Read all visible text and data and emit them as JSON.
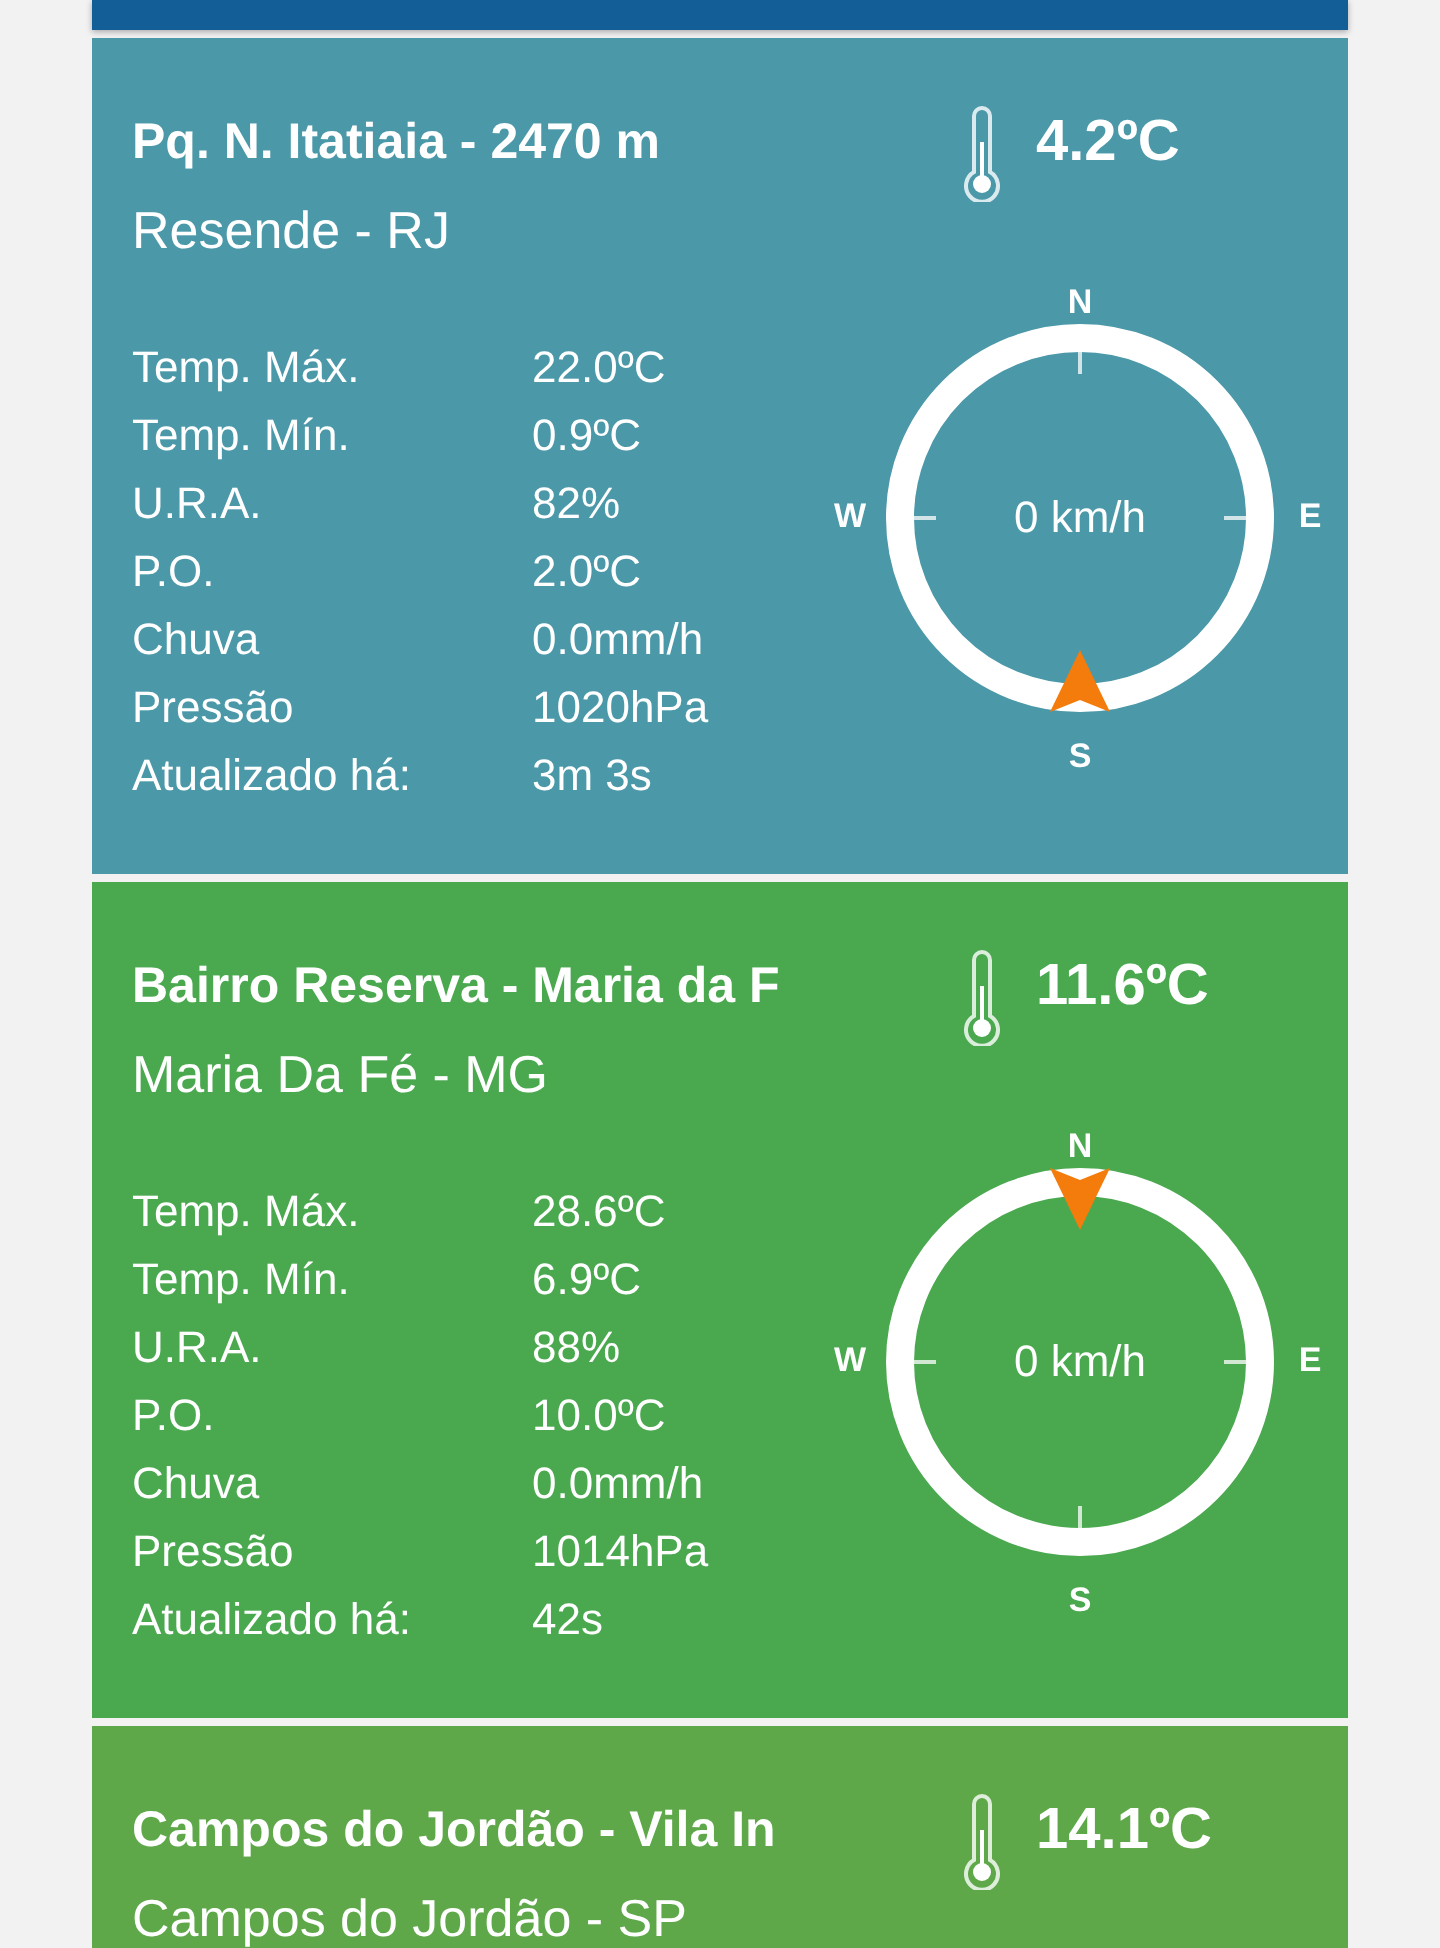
{
  "stations": [
    {
      "title": "Pq. N. Itatiaia - 2470 m",
      "subtitle": "Resende - RJ",
      "temperature": "4.2ºC",
      "color": "#4a98a8",
      "stats": [
        {
          "label": "Temp. Máx.",
          "value": "22.0ºC"
        },
        {
          "label": "Temp. Mín.",
          "value": "0.9ºC"
        },
        {
          "label": "U.R.A.",
          "value": "82%"
        },
        {
          "label": "P.O.",
          "value": "2.0ºC"
        },
        {
          "label": "Chuva",
          "value": "0.0mm/h"
        },
        {
          "label": "Pressão",
          "value": "1020hPa"
        },
        {
          "label": "Atualizado há:",
          "value": "3m 3s"
        }
      ],
      "compass": {
        "labels": [
          "N",
          "E",
          "S",
          "W"
        ],
        "speed": "0 km/h",
        "arrow_at_south": true
      }
    },
    {
      "title": "Bairro Reserva - Maria da F",
      "subtitle": "Maria Da Fé - MG",
      "temperature": "11.6ºC",
      "color": "#4aa84f",
      "stats": [
        {
          "label": "Temp. Máx.",
          "value": "28.6ºC"
        },
        {
          "label": "Temp. Mín.",
          "value": "6.9ºC"
        },
        {
          "label": "U.R.A.",
          "value": "88%"
        },
        {
          "label": "P.O.",
          "value": "10.0ºC"
        },
        {
          "label": "Chuva",
          "value": "0.0mm/h"
        },
        {
          "label": "Pressão",
          "value": "1014hPa"
        },
        {
          "label": "Atualizado há:",
          "value": "42s"
        }
      ],
      "compass": {
        "labels": [
          "N",
          "E",
          "S",
          "W"
        ],
        "speed": "0 km/h",
        "arrow_at_south": false
      }
    },
    {
      "title": "Campos do Jordão - Vila In",
      "subtitle": "Campos do Jordão - SP",
      "temperature": "14.1ºC",
      "color": "#5fa84a"
    }
  ]
}
